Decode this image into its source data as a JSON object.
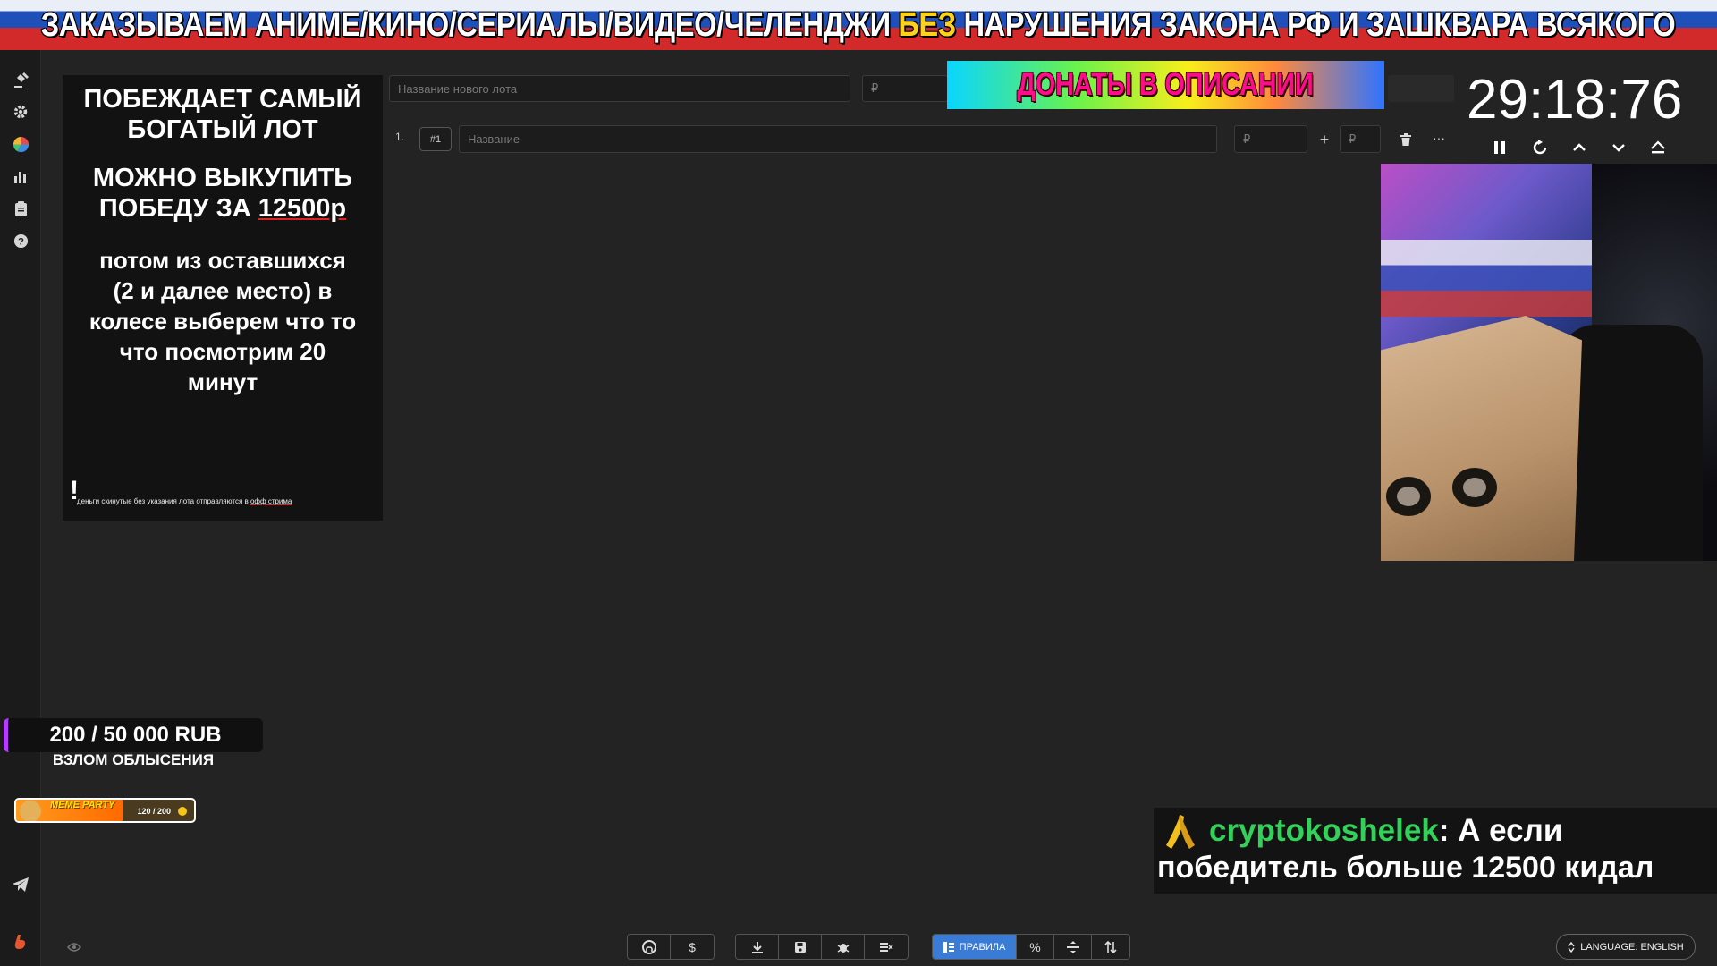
{
  "banner": {
    "part1": "ЗАКАЗЫВАЕМ АНИМЕ/КИНО/СЕРИАЛЫ/ВИДЕО/ЧЕЛЕНДЖИ ",
    "highlight": "БЕЗ",
    "part2": " НАРУШЕНИЯ ЗАКОНА РФ И ЗАШКВАРА ВСЯКОГО"
  },
  "sidebar": {
    "icons": [
      "gavel-icon",
      "gear-icon",
      "pie-chart-icon",
      "bar-chart-icon",
      "clipboard-icon",
      "help-icon",
      "telegram-icon",
      "brand-logo-icon"
    ]
  },
  "rules": {
    "line1": "ПОБЕЖДАЕТ САМЫЙ БОГАТЫЙ ЛОТ",
    "line2_prefix": "МОЖНО ВЫКУПИТЬ ПОБЕДУ ЗА ",
    "line2_amount": "12500р",
    "line3": "потом из оставшихся (2 и далее место) в колесе выберем что то что посмотрим 20 минут",
    "excl": "!",
    "fine_prefix": "деньги скинутые без указания лота отправляются в ",
    "fine_link": "офф стрима"
  },
  "new_lot": {
    "name_placeholder": "Название нового лота",
    "amount_placeholder": "₽"
  },
  "lot_row": {
    "index": "1.",
    "tag": "#1",
    "name_placeholder": "Название",
    "amount_placeholder": "₽",
    "plus": "+",
    "add_placeholder": "₽",
    "more": "···"
  },
  "donate_banner": "ДОНАТЫ В ОПИСАНИИ",
  "timer": "29:18:76",
  "controls": [
    "pause-icon",
    "restart-icon",
    "chevron-up-icon",
    "chevron-down-icon",
    "eject-icon"
  ],
  "goal": {
    "amount": "200 / 50 000 RUB",
    "label": "ВЗЛОМ ОБЛЫСЕНИЯ",
    "accent": "#b53bff"
  },
  "meme_party": {
    "label": "MEME PARTY",
    "count": "120 / 200",
    "progress": 0.6
  },
  "chat": {
    "username": "cryptokoshelek",
    "line1_text": ": А если",
    "line2_text": "победитель больше 12500 кидал",
    "user_color": "#32d15a"
  },
  "toolbar": {
    "rules_label": "ПРАВИЛА",
    "dollar": "$",
    "percent": "%"
  },
  "language": "LANGUAGE: ENGLISH",
  "colors": {
    "accent_blue": "#3a7bd5",
    "banner_highlight": "#ffd21a",
    "donate_text": "#ff0c8e"
  }
}
